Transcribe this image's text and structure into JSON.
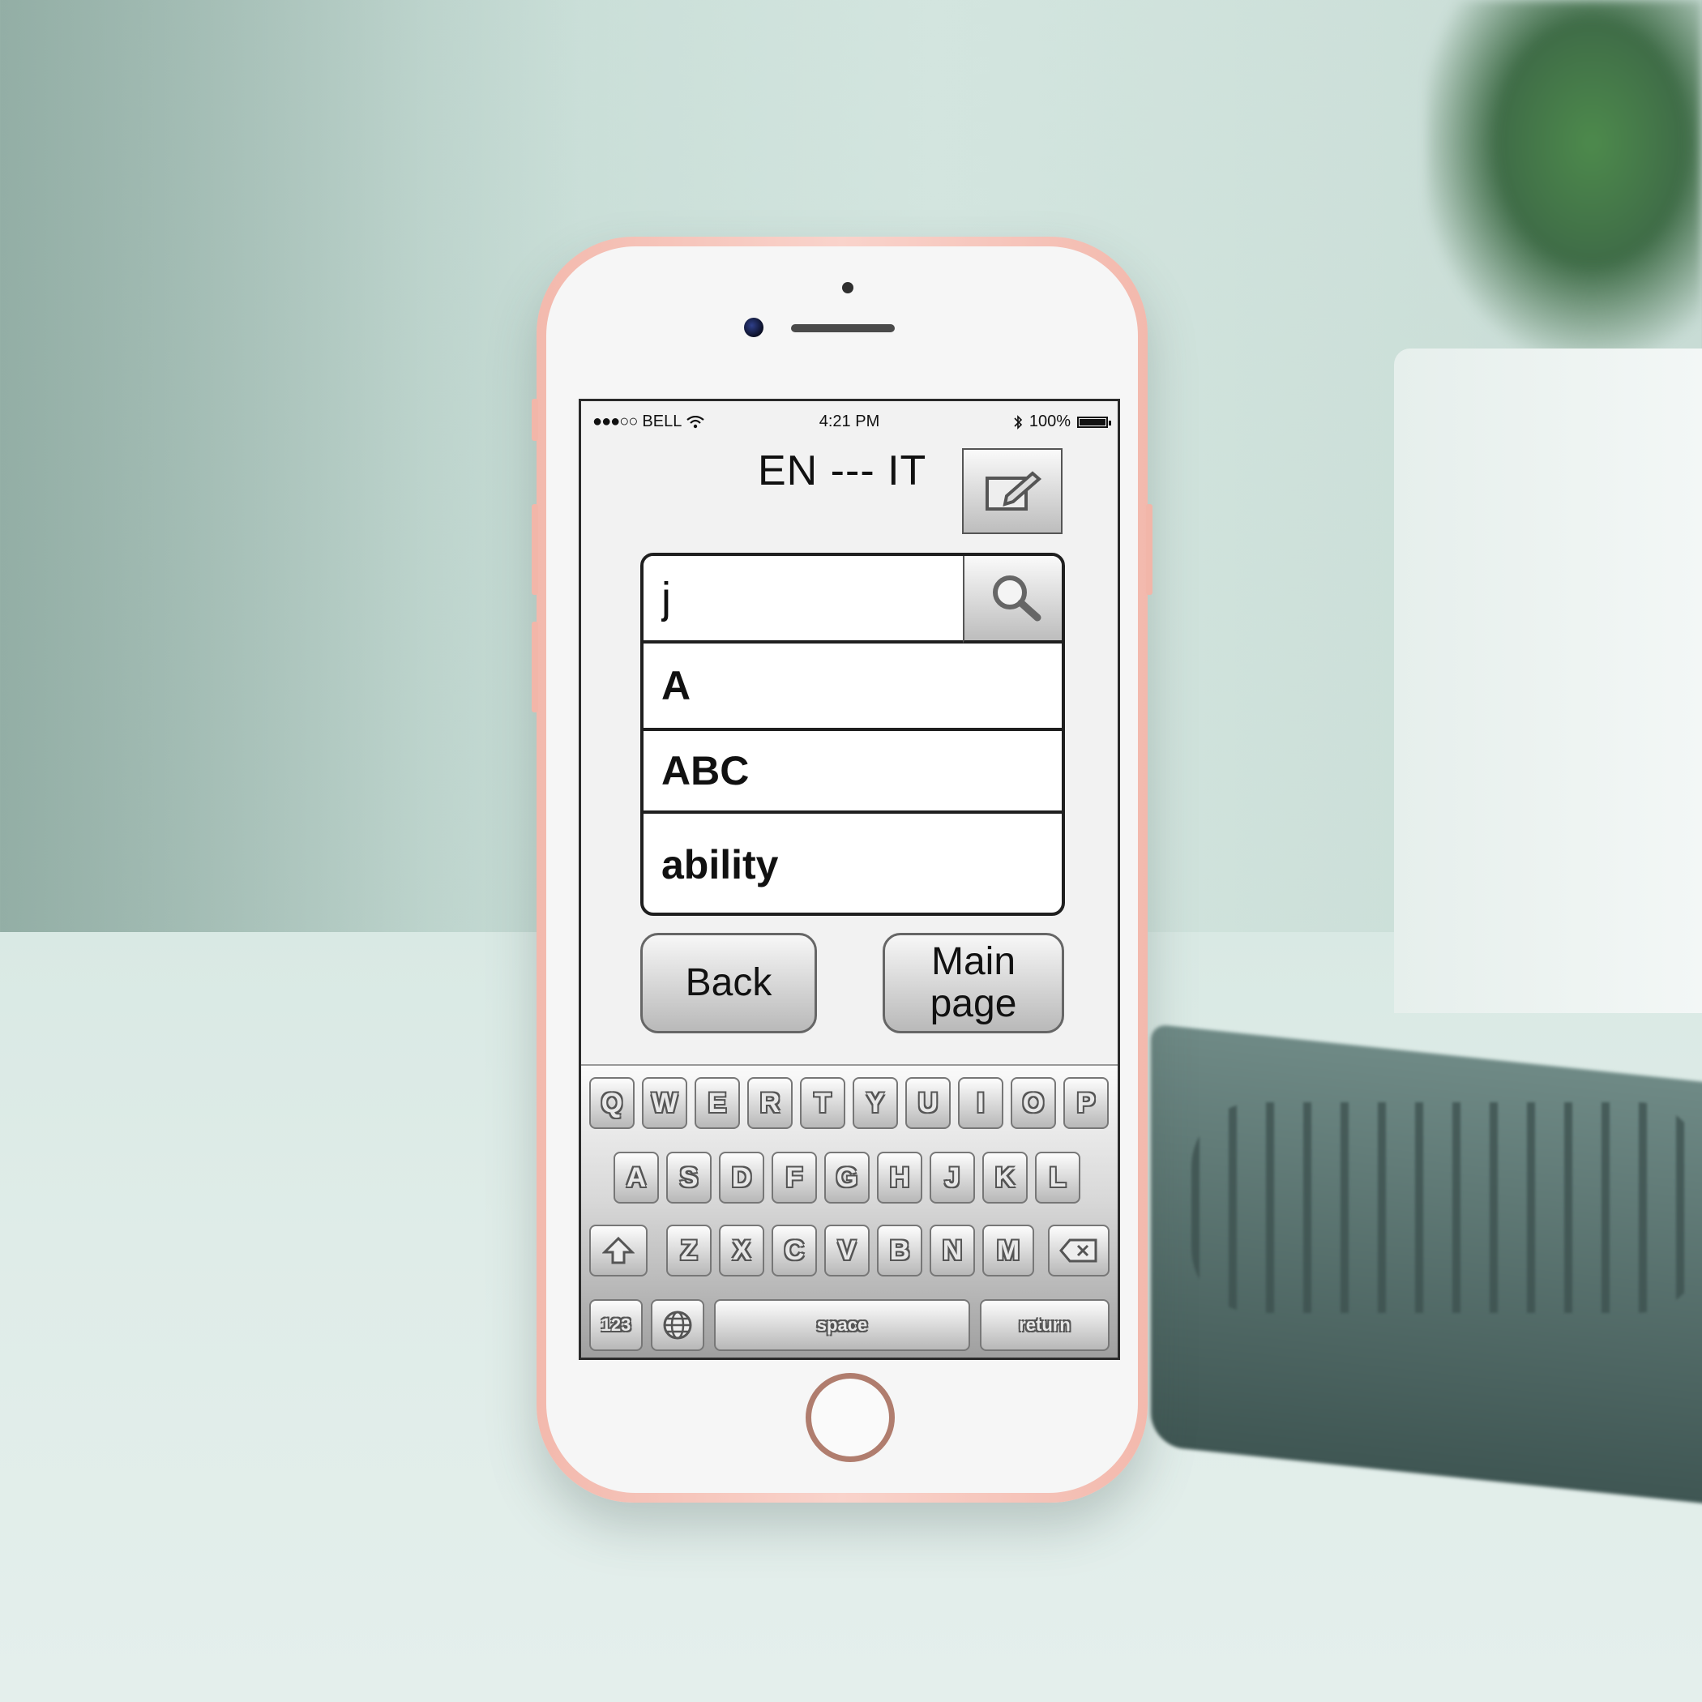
{
  "status_bar": {
    "signal": "●●●○○",
    "carrier": "BELL",
    "time": "4:21 PM",
    "bluetooth": "∗",
    "battery": "100%"
  },
  "header": {
    "title": "EN --- IT"
  },
  "search": {
    "value": "j",
    "placeholder": ""
  },
  "results": [
    {
      "label": "A"
    },
    {
      "label": "ABC"
    },
    {
      "label": "ability"
    }
  ],
  "buttons": {
    "back": "Back",
    "main_page_line1": "Main",
    "main_page_line2": "page"
  },
  "keyboard": {
    "row1": [
      "Q",
      "W",
      "E",
      "R",
      "T",
      "Y",
      "U",
      "I",
      "O",
      "P"
    ],
    "row2": [
      "A",
      "S",
      "D",
      "F",
      "G",
      "H",
      "J",
      "K",
      "L"
    ],
    "row3": [
      "Z",
      "X",
      "C",
      "V",
      "B",
      "N",
      "M"
    ],
    "numbers": "123",
    "space": "space",
    "return": "return"
  },
  "colors": {
    "phone_body": "#f3b9ad",
    "screen_bg": "#f2f2f2",
    "accent": "#1f1f1f"
  }
}
